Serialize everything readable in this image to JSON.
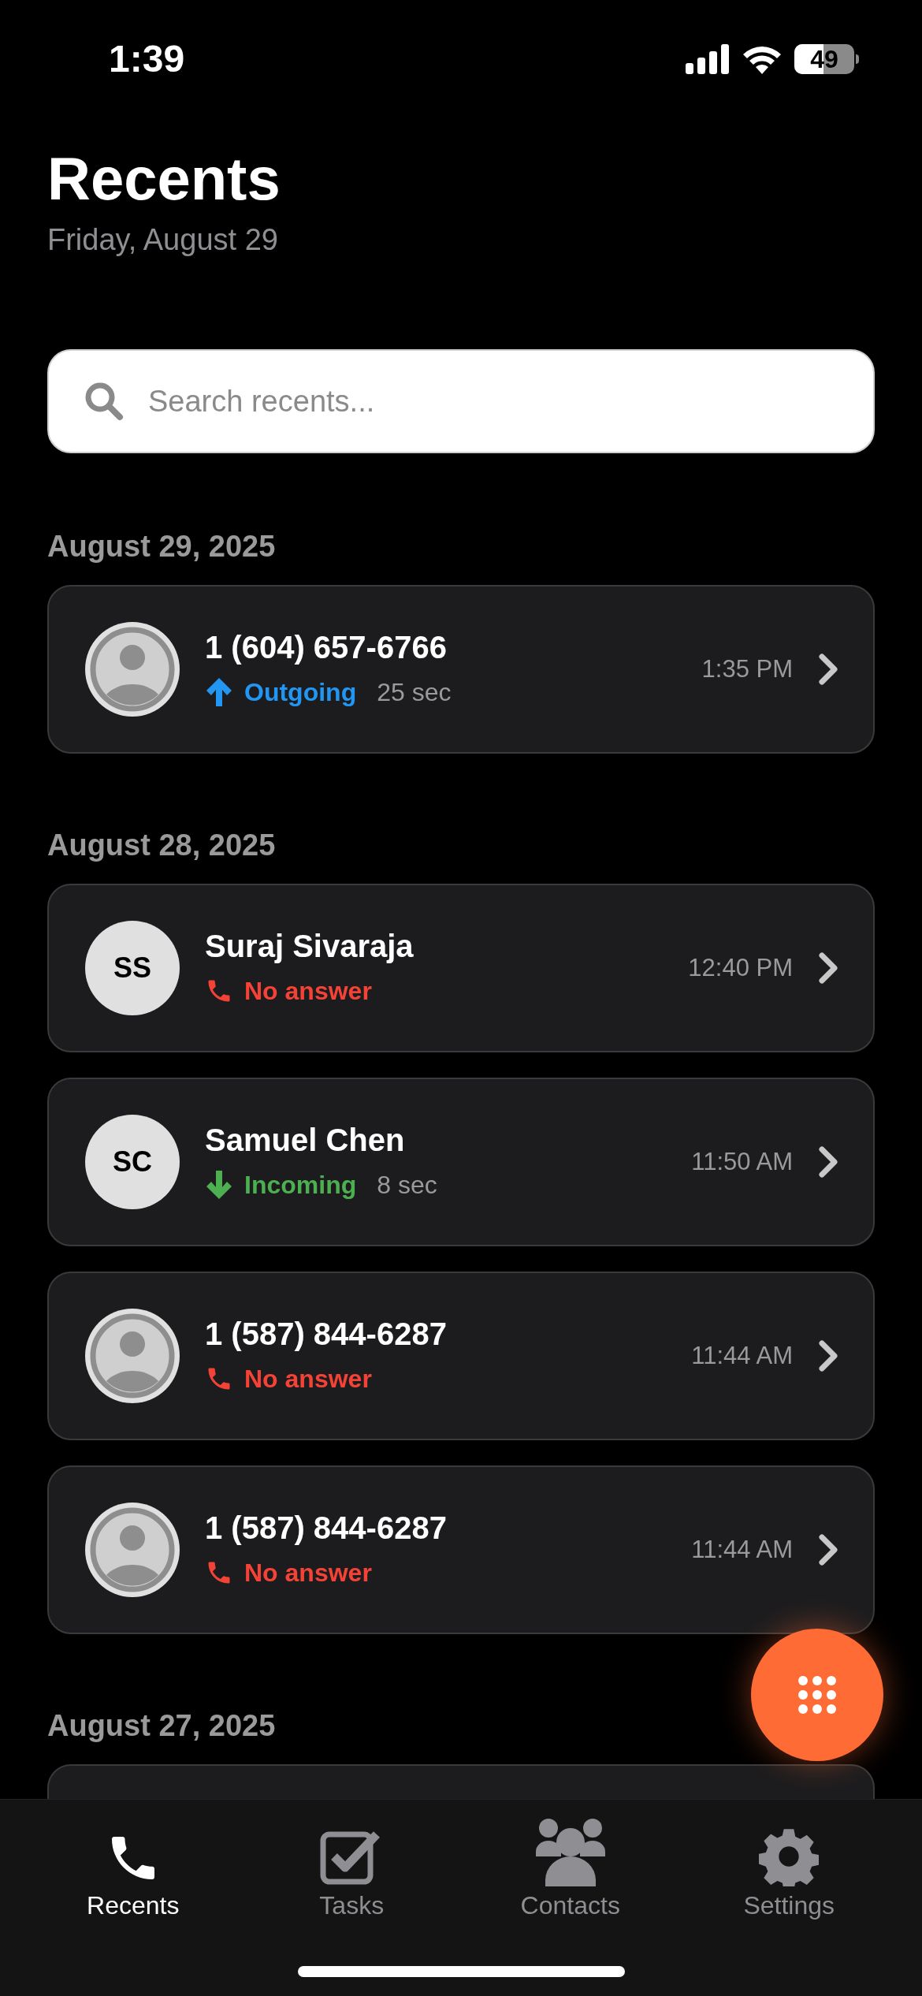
{
  "status_bar": {
    "time": "1:39",
    "battery": "49"
  },
  "header": {
    "title": "Recents",
    "subtitle": "Friday, August 29"
  },
  "search": {
    "placeholder": "Search recents..."
  },
  "sections": [
    {
      "date": "August 29, 2025",
      "calls": [
        {
          "avatar": {
            "kind": "placeholder"
          },
          "name": "1 (604) 657-6766",
          "kind": "outgoing",
          "status": "Outgoing",
          "duration": "25 sec",
          "time": "1:35 PM"
        }
      ]
    },
    {
      "date": "August 28, 2025",
      "calls": [
        {
          "avatar": {
            "kind": "initials",
            "initials": "SS"
          },
          "name": "Suraj Sivaraja",
          "kind": "missed",
          "status": "No answer",
          "time": "12:40 PM"
        },
        {
          "avatar": {
            "kind": "initials",
            "initials": "SC"
          },
          "name": "Samuel Chen",
          "kind": "incoming",
          "status": "Incoming",
          "duration": "8 sec",
          "time": "11:50 AM"
        },
        {
          "avatar": {
            "kind": "placeholder"
          },
          "name": "1 (587) 844-6287",
          "kind": "missed",
          "status": "No answer",
          "time": "11:44 AM"
        },
        {
          "avatar": {
            "kind": "placeholder"
          },
          "name": "1 (587) 844-6287",
          "kind": "missed",
          "status": "No answer",
          "time": "11:44 AM"
        }
      ]
    },
    {
      "date": "August 27, 2025",
      "calls": [
        {
          "kind": "cut_off"
        }
      ]
    }
  ],
  "tabs": [
    {
      "label": "Recents",
      "kind": "phone",
      "selected": true
    },
    {
      "label": "Tasks",
      "kind": "check",
      "selected": false
    },
    {
      "label": "Contacts",
      "kind": "people",
      "selected": false
    },
    {
      "label": "Settings",
      "kind": "gear",
      "selected": false
    }
  ]
}
